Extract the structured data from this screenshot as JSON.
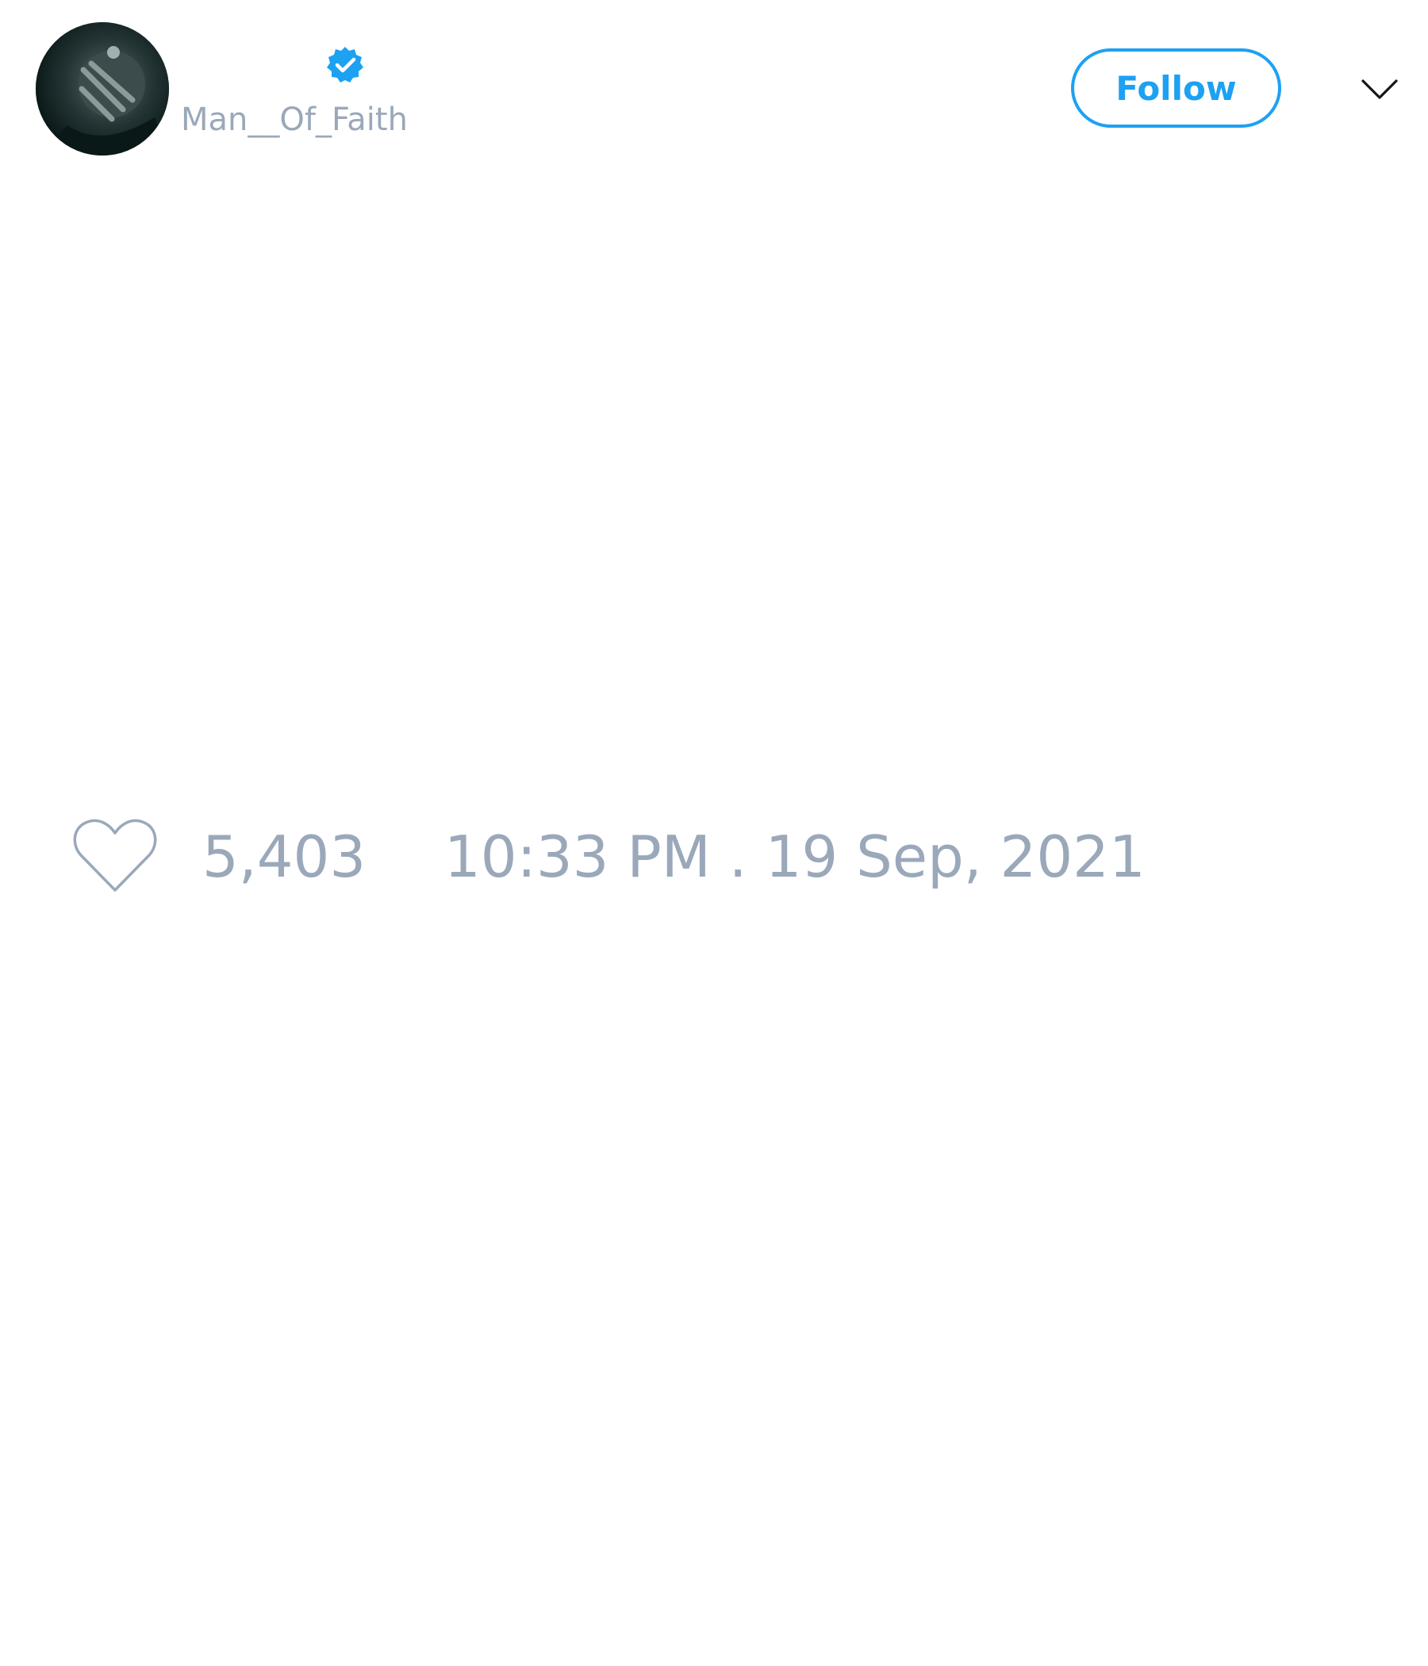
{
  "tweet": {
    "author": {
      "display_name": "",
      "handle": "Man__Of_Faith",
      "verified": true,
      "avatar_icon": "profile-photo"
    },
    "follow_label": "Follow",
    "menu_icon": "chevron-down-icon",
    "likes": {
      "icon": "heart-outline-icon",
      "count": "5,403"
    },
    "timestamp": "10:33 PM . 19 Sep, 2021"
  },
  "colors": {
    "accent": "#1da1f2",
    "muted_text": "#9aa8ba",
    "background": "#ffffff"
  }
}
